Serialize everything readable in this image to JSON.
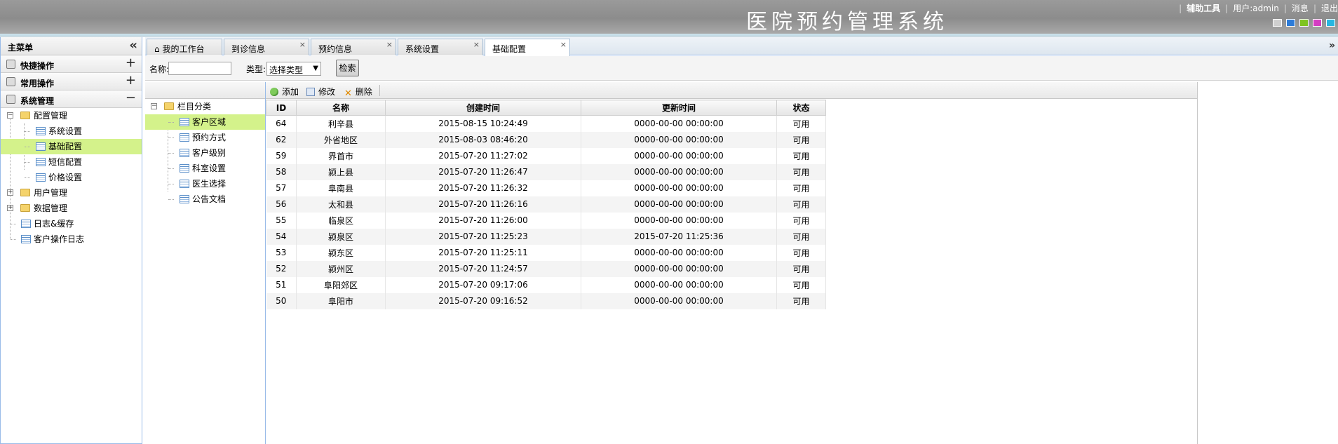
{
  "header": {
    "title": "医院预约管理系统",
    "links": [
      "辅助工具",
      "用户:admin",
      "消息",
      "退出"
    ],
    "swatch_colors": [
      "#cfcfcf",
      "#2c7bd8",
      "#7ec421",
      "#d43cc2",
      "#27b6e0"
    ]
  },
  "sidebar": {
    "title": "主菜单",
    "sections": [
      {
        "label": "快捷操作",
        "sign": "+"
      },
      {
        "label": "常用操作",
        "sign": "+"
      },
      {
        "label": "系统管理",
        "sign": "−"
      }
    ],
    "tree": [
      {
        "label": "配置管理",
        "type": "folder",
        "expanded": "−"
      },
      {
        "label": "系统设置",
        "type": "doc"
      },
      {
        "label": "基础配置",
        "type": "doc",
        "selected": true
      },
      {
        "label": "短信配置",
        "type": "doc"
      },
      {
        "label": "价格设置",
        "type": "doc"
      },
      {
        "label": "用户管理",
        "type": "folder",
        "expanded": "+"
      },
      {
        "label": "数据管理",
        "type": "folder",
        "expanded": "+"
      },
      {
        "label": "日志&缓存",
        "type": "doc"
      },
      {
        "label": "客户操作日志",
        "type": "doc"
      }
    ]
  },
  "tabs": [
    {
      "label": "我的工作台"
    },
    {
      "label": "到诊信息",
      "close": "×"
    },
    {
      "label": "预约信息",
      "close": "×"
    },
    {
      "label": "系统设置",
      "close": "×"
    },
    {
      "label": "基础配置",
      "close": "×",
      "active": true
    }
  ],
  "search": {
    "name_label": "名称:",
    "name_value": "",
    "type_label": "类型:",
    "type_selected": "选择类型",
    "search_button": "检索"
  },
  "categories": {
    "root": "栏目分类",
    "root_sign": "−",
    "items": [
      "客户区域",
      "预约方式",
      "客户级别",
      "科室设置",
      "医生选择",
      "公告文档"
    ],
    "selected": "客户区域"
  },
  "grid": {
    "toolbar": {
      "add": "添加",
      "edit": "修改",
      "delete": "删除"
    },
    "columns": [
      "ID",
      "名称",
      "创建时间",
      "更新时间",
      "状态"
    ],
    "rows": [
      [
        "64",
        "利辛县",
        "2015-08-15 10:24:49",
        "0000-00-00 00:00:00",
        "可用"
      ],
      [
        "62",
        "外省地区",
        "2015-08-03 08:46:20",
        "0000-00-00 00:00:00",
        "可用"
      ],
      [
        "59",
        "界首市",
        "2015-07-20 11:27:02",
        "0000-00-00 00:00:00",
        "可用"
      ],
      [
        "58",
        "颍上县",
        "2015-07-20 11:26:47",
        "0000-00-00 00:00:00",
        "可用"
      ],
      [
        "57",
        "阜南县",
        "2015-07-20 11:26:32",
        "0000-00-00 00:00:00",
        "可用"
      ],
      [
        "56",
        "太和县",
        "2015-07-20 11:26:16",
        "0000-00-00 00:00:00",
        "可用"
      ],
      [
        "55",
        "临泉区",
        "2015-07-20 11:26:00",
        "0000-00-00 00:00:00",
        "可用"
      ],
      [
        "54",
        "颍泉区",
        "2015-07-20 11:25:23",
        "2015-07-20 11:25:36",
        "可用"
      ],
      [
        "53",
        "颍东区",
        "2015-07-20 11:25:11",
        "0000-00-00 00:00:00",
        "可用"
      ],
      [
        "52",
        "颍州区",
        "2015-07-20 11:24:57",
        "0000-00-00 00:00:00",
        "可用"
      ],
      [
        "51",
        "阜阳郊区",
        "2015-07-20 09:17:06",
        "0000-00-00 00:00:00",
        "可用"
      ],
      [
        "50",
        "阜阳市",
        "2015-07-20 09:16:52",
        "0000-00-00 00:00:00",
        "可用"
      ]
    ]
  }
}
